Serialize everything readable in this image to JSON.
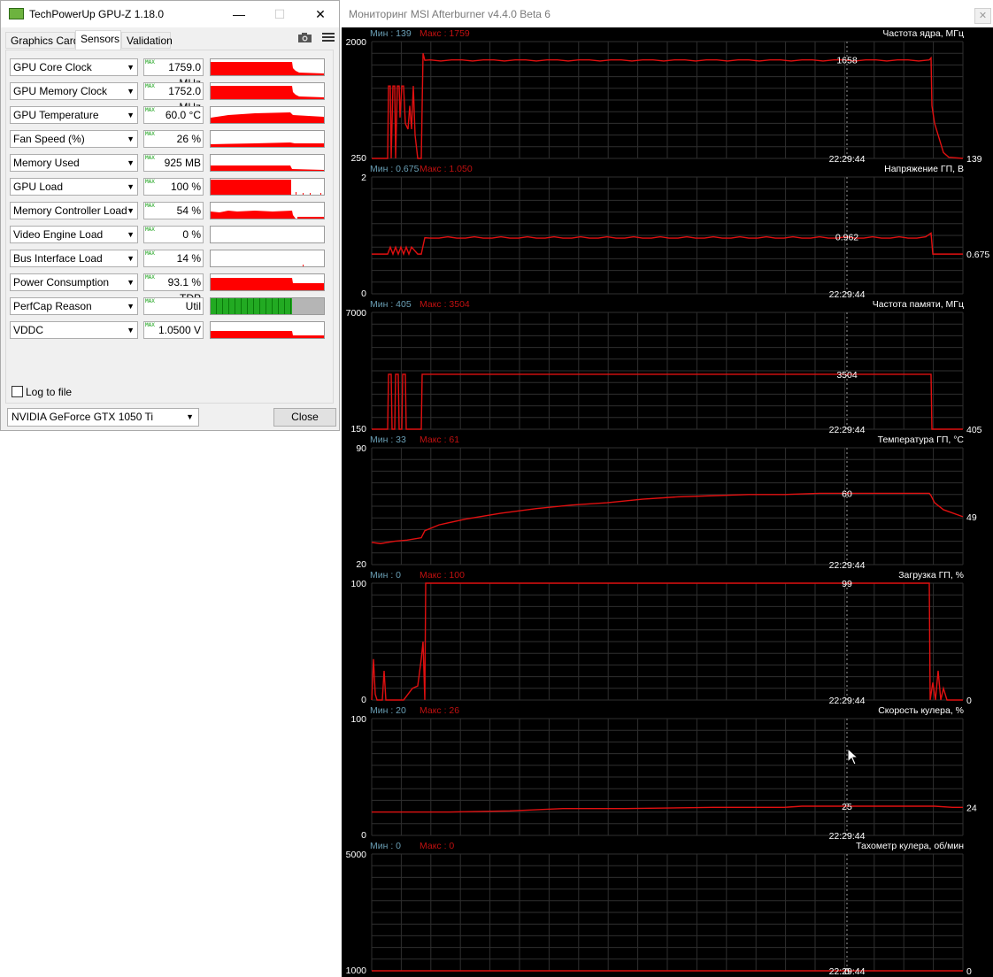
{
  "gpuz": {
    "title": "TechPowerUp GPU-Z 1.18.0",
    "window_controls": {
      "minimize": "—",
      "maximize": "☐",
      "close": "✕"
    },
    "tabs": [
      {
        "label": "Graphics Card",
        "active": false
      },
      {
        "label": "Sensors",
        "active": true
      },
      {
        "label": "Validation",
        "active": false
      }
    ],
    "camera_icon": "camera-icon",
    "menu_icon": "hamburger-menu-icon",
    "max_tag": "MAX",
    "sensors": [
      {
        "name": "GPU Core Clock",
        "value": "1759.0 MHz",
        "graph": "clock",
        "color": "#ff0000"
      },
      {
        "name": "GPU Memory Clock",
        "value": "1752.0 MHz",
        "graph": "clock",
        "color": "#ff0000"
      },
      {
        "name": "GPU Temperature",
        "value": "60.0 °C",
        "graph": "temp",
        "color": "#ff0000"
      },
      {
        "name": "Fan Speed (%)",
        "value": "26 %",
        "graph": "fan",
        "color": "#ff0000"
      },
      {
        "name": "Memory Used",
        "value": "925 MB",
        "graph": "mem",
        "color": "#ff0000"
      },
      {
        "name": "GPU Load",
        "value": "100 %",
        "graph": "load",
        "color": "#ff0000"
      },
      {
        "name": "Memory Controller Load",
        "value": "54 %",
        "graph": "mcl",
        "color": "#ff0000"
      },
      {
        "name": "Video Engine Load",
        "value": "0 %",
        "graph": "none",
        "color": "#ff0000"
      },
      {
        "name": "Bus Interface Load",
        "value": "14 %",
        "graph": "bus",
        "color": "#ff0000"
      },
      {
        "name": "Power Consumption",
        "value": "93.1 % TDP",
        "graph": "power",
        "color": "#ff0000"
      },
      {
        "name": "PerfCap Reason",
        "value": "Util",
        "graph": "perfcap",
        "color": "#22aa22"
      },
      {
        "name": "VDDC",
        "value": "1.0500 V",
        "graph": "vddc",
        "color": "#ff0000"
      }
    ],
    "log_to_file": {
      "label": "Log to file",
      "checked": false
    },
    "gpu_select": "NVIDIA GeForce GTX 1050 Ti",
    "close_label": "Close"
  },
  "afterburner": {
    "title": "Мониторинг MSI Afterburner v4.4.0 Beta 6",
    "close_icon": "✕",
    "time_label": "22:29:44",
    "colors": {
      "grid": "#2f2f2f",
      "line": "#e01010",
      "min_text": "#6a9fb5",
      "max_text": "#c01010",
      "text": "#ffffff"
    },
    "graphs": [
      {
        "title": "Частота ядра, МГц",
        "min_text": "Мин : 139",
        "max_text": "Макс : 1759",
        "y_top": "2000",
        "y_bottom": "250",
        "current": "1658",
        "right": "139"
      },
      {
        "title": "Напряжение ГП, В",
        "min_text": "Мин : 0.675",
        "max_text": "Макс : 1.050",
        "y_top": "2",
        "y_bottom": "0",
        "current": "0.962",
        "right": "0.675"
      },
      {
        "title": "Частота памяти, МГц",
        "min_text": "Мин : 405",
        "max_text": "Макс : 3504",
        "y_top": "7000",
        "y_bottom": "150",
        "current": "3504",
        "right": "405"
      },
      {
        "title": "Температура ГП, °C",
        "min_text": "Мин : 33",
        "max_text": "Макс : 61",
        "y_top": "90",
        "y_bottom": "20",
        "current": "60",
        "right": "49"
      },
      {
        "title": "Загрузка ГП, %",
        "min_text": "Мин : 0",
        "max_text": "Макс : 100",
        "y_top": "100",
        "y_bottom": "0",
        "current": "99",
        "right": "0"
      },
      {
        "title": "Скорость кулера, %",
        "min_text": "Мин : 20",
        "max_text": "Макс : 26",
        "y_top": "100",
        "y_bottom": "0",
        "current": "25",
        "right": "24"
      },
      {
        "title": "Тахометр кулера, об/мин",
        "min_text": "Мин : 0",
        "max_text": "Макс : 0",
        "y_top": "5000",
        "y_bottom": "1000",
        "current": "0",
        "right": "0"
      }
    ]
  }
}
